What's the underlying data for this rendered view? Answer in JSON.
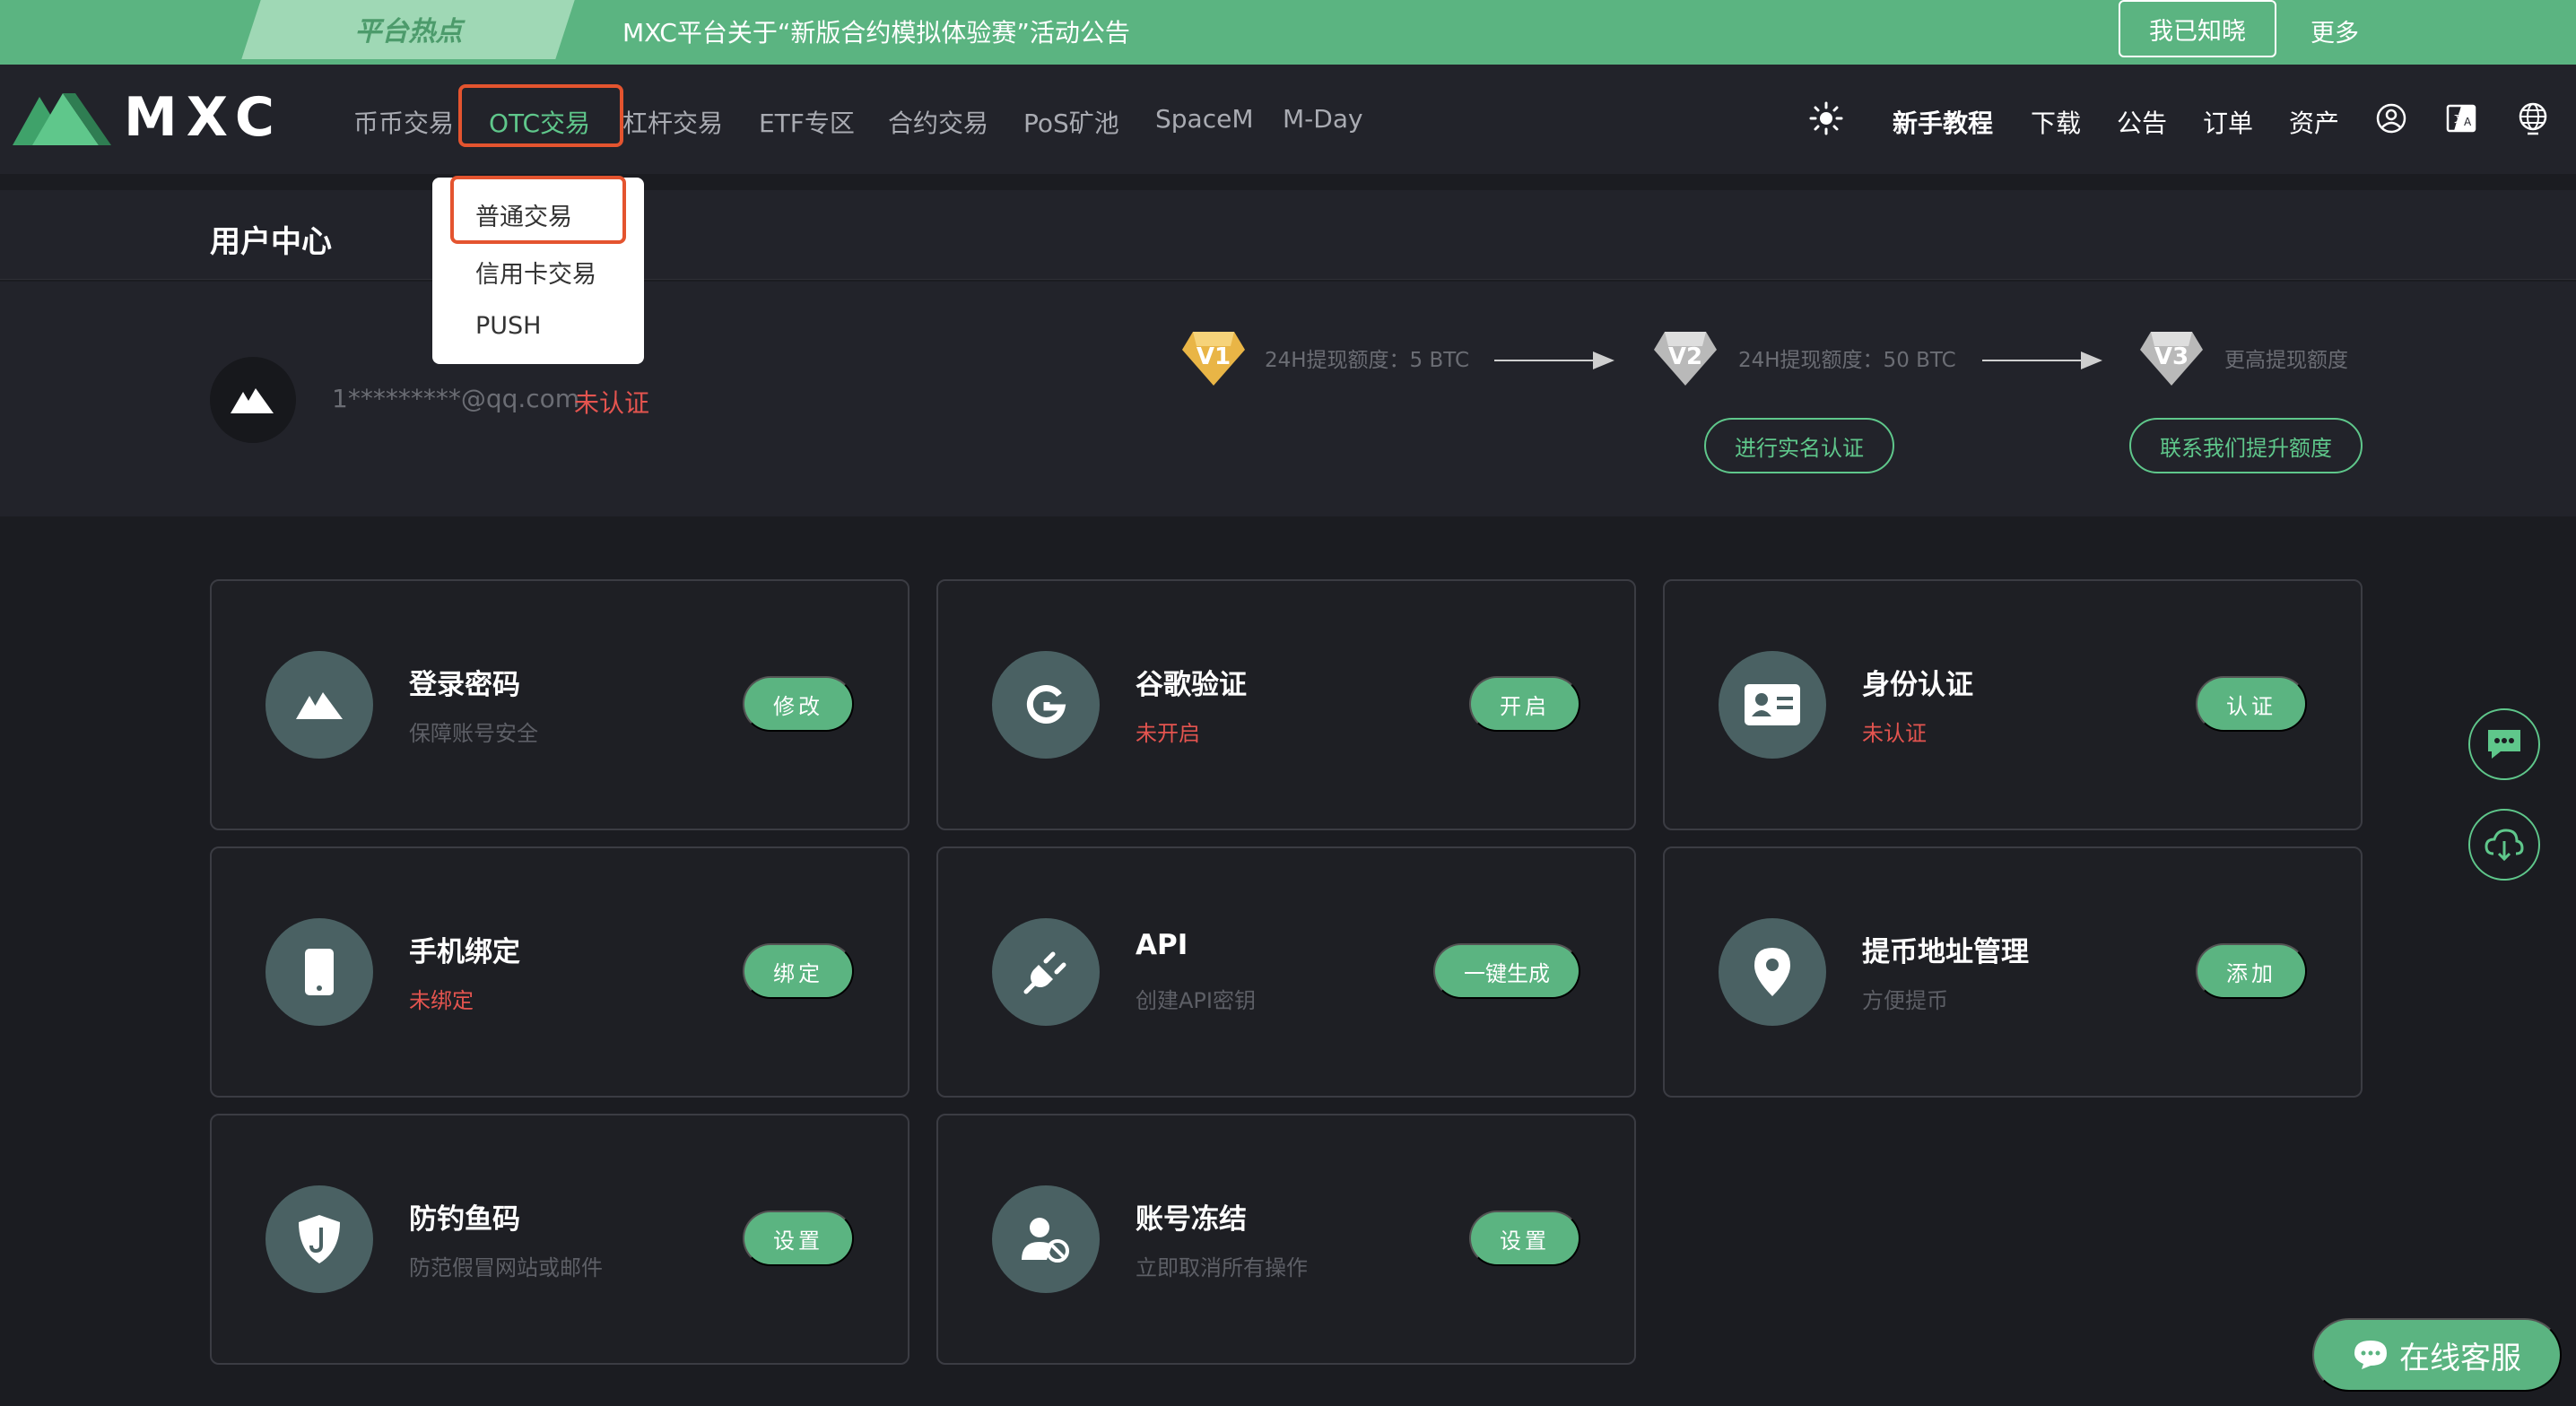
{
  "announcement": {
    "tag": "平台热点",
    "text": "MXC平台关于“新版合约模拟体验赛”活动公告",
    "ack_button": "我已知晓",
    "more": "更多"
  },
  "brand": {
    "logo_text": "MXC",
    "accent": "#5bb481"
  },
  "nav": {
    "items": [
      "币币交易",
      "OTC交易",
      "杠杆交易",
      "ETF专区",
      "合约交易",
      "PoS矿池",
      "SpaceM",
      "M-Day"
    ],
    "active": "OTC交易",
    "right": [
      "新手教程",
      "下载",
      "公告",
      "订单",
      "资产"
    ]
  },
  "otc_menu": [
    "普通交易",
    "信用卡交易",
    "PUSH"
  ],
  "page": {
    "title": "用户中心"
  },
  "profile": {
    "email": "1*********@qq.com",
    "status": "未认证",
    "levels": [
      {
        "badge": "V1",
        "text": "24H提现额度：5 BTC",
        "color": "#f0c050"
      },
      {
        "badge": "V2",
        "text": "24H提现额度：50 BTC",
        "color": "#c8c8c8"
      },
      {
        "badge": "V3",
        "text": "更高提现额度",
        "color": "#c8c8c8"
      }
    ],
    "verify_button": "进行实名认证",
    "contact_button": "联系我们提升额度"
  },
  "cards": [
    {
      "icon": "mxc-logo-icon",
      "title": "登录密码",
      "sub": "保障账号安全",
      "sub_red": false,
      "button": "修改"
    },
    {
      "icon": "google-icon",
      "title": "谷歌验证",
      "sub": "未开启",
      "sub_red": true,
      "button": "开启"
    },
    {
      "icon": "id-card-icon",
      "title": "身份认证",
      "sub": "未认证",
      "sub_red": true,
      "button": "认证"
    },
    {
      "icon": "phone-icon",
      "title": "手机绑定",
      "sub": "未绑定",
      "sub_red": true,
      "button": "绑定"
    },
    {
      "icon": "plug-icon",
      "title": "API",
      "sub": "创建API密钥",
      "sub_red": false,
      "button": "一键生成"
    },
    {
      "icon": "location-pin-icon",
      "title": "提币地址管理",
      "sub": "方便提币",
      "sub_red": false,
      "button": "添加"
    },
    {
      "icon": "shield-hook-icon",
      "title": "防钓鱼码",
      "sub": "防范假冒网站或邮件",
      "sub_red": false,
      "button": "设置"
    },
    {
      "icon": "user-block-icon",
      "title": "账号冻结",
      "sub": "立即取消所有操作",
      "sub_red": false,
      "button": "设置"
    }
  ],
  "support": {
    "label": "在线客服"
  },
  "colors": {
    "danger": "#e4544f",
    "green": "#5fc78b",
    "bg": "#1b1c21"
  }
}
